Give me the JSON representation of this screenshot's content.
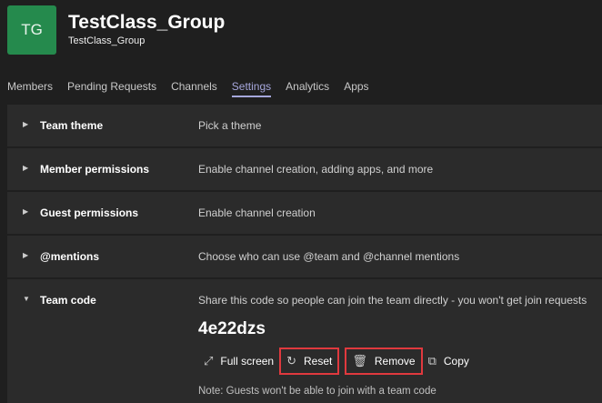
{
  "header": {
    "avatar_initials": "TG",
    "title": "TestClass_Group",
    "subtitle": "TestClass_Group",
    "more_label": "···"
  },
  "tabs": [
    {
      "label": "Members"
    },
    {
      "label": "Pending Requests"
    },
    {
      "label": "Channels"
    },
    {
      "label": "Settings",
      "active": true
    },
    {
      "label": "Analytics"
    },
    {
      "label": "Apps"
    }
  ],
  "settings": [
    {
      "name": "Team theme",
      "desc": "Pick a theme"
    },
    {
      "name": "Member permissions",
      "desc": "Enable channel creation, adding apps, and more"
    },
    {
      "name": "Guest permissions",
      "desc": "Enable channel creation"
    },
    {
      "name": "@mentions",
      "desc": "Choose who can use @team and @channel mentions"
    },
    {
      "name": "Team code",
      "desc": "Share this code so people can join the team directly - you won't get join requests"
    }
  ],
  "team_code": {
    "code": "4e22dzs",
    "full_screen": "Full screen",
    "reset": "Reset",
    "remove": "Remove",
    "copy": "Copy",
    "note": "Note: Guests won't be able to join with a team code"
  },
  "colors": {
    "avatar": "#258a4d",
    "accent": "#a6a7dc",
    "highlight": "#e0393e"
  }
}
